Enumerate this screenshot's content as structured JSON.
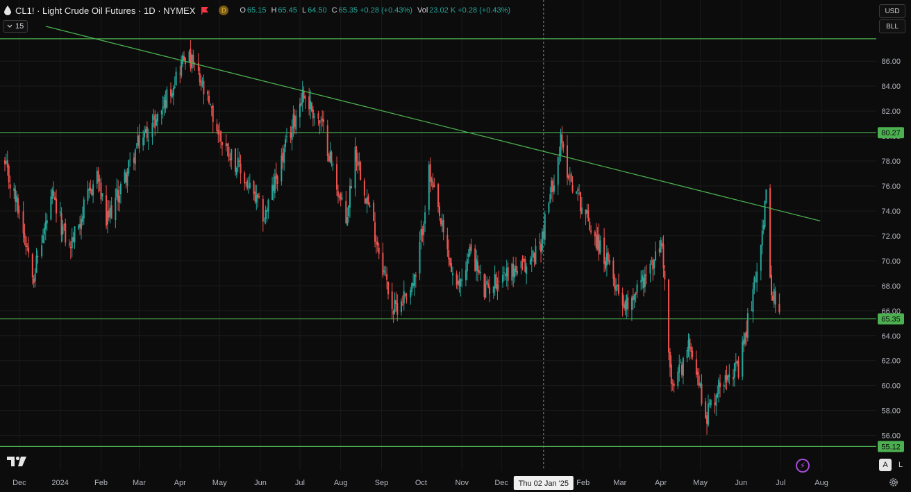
{
  "header": {
    "symbol": "CL1! · Light Crude Oil Futures · 1D · NYMEX",
    "d_badge": "D",
    "ohlc": [
      {
        "k": "O",
        "v": "65.15"
      },
      {
        "k": "H",
        "v": "65.45"
      },
      {
        "k": "L",
        "v": "64.50"
      },
      {
        "k": "C",
        "v": "65.35 +0.28 (+0.43%)"
      },
      {
        "k": "Vol",
        "v": "23.02 K +0.28 (+0.43%)"
      }
    ]
  },
  "interval_badge": "15",
  "currency_button": "USD",
  "unit_button": "BLL",
  "crosshair_label": "Thu 02 Jan '25",
  "toggles": {
    "auto": "A",
    "log": "L"
  },
  "colors": {
    "up": "#26a69a",
    "down": "#ef5350",
    "level": "#4caf50",
    "grid": "#1a1a1a",
    "label_bg": "#4caf50"
  },
  "chart_data": {
    "type": "candlestick",
    "title": "CL1! · Light Crude Oil Futures · 1D · NYMEX",
    "ylim": [
      54.5,
      88.5
    ],
    "yticks": [
      56,
      58,
      60,
      62,
      64,
      66,
      68,
      70,
      72,
      74,
      76,
      78,
      80,
      82,
      84,
      86
    ],
    "xticks": [
      "Dec",
      "2024",
      "Feb",
      "Mar",
      "Apr",
      "May",
      "Jun",
      "Jul",
      "Aug",
      "Sep",
      "Oct",
      "Nov",
      "Dec",
      "Feb",
      "Mar",
      "Apr",
      "May",
      "Jun",
      "Jul",
      "Aug"
    ],
    "x_range": [
      "2023-11-20",
      "2025-08-31"
    ],
    "grid": true,
    "horizontal_levels": [
      {
        "price": 87.8,
        "label": ""
      },
      {
        "price": 80.27,
        "label": "80.27"
      },
      {
        "price": 65.35,
        "label": "65.35"
      },
      {
        "price": 55.12,
        "label": "55.12"
      }
    ],
    "trendline": {
      "from": {
        "date": "2023-12-21",
        "price": 88.8
      },
      "to": {
        "date": "2025-07-31",
        "price": 73.2
      }
    },
    "crosshair": {
      "date": "2025-01-02"
    },
    "price_path": [
      [
        "2023-11-20",
        77.5
      ],
      [
        "2023-12-01",
        74.0
      ],
      [
        "2023-12-12",
        69.0
      ],
      [
        "2023-12-26",
        75.0
      ],
      [
        "2024-01-08",
        71.0
      ],
      [
        "2024-01-29",
        77.0
      ],
      [
        "2024-02-05",
        73.0
      ],
      [
        "2024-03-01",
        79.5
      ],
      [
        "2024-03-15",
        81.5
      ],
      [
        "2024-04-05",
        86.5
      ],
      [
        "2024-04-12",
        85.5
      ],
      [
        "2024-05-01",
        80.0
      ],
      [
        "2024-05-10",
        78.5
      ],
      [
        "2024-06-04",
        73.5
      ],
      [
        "2024-07-03",
        83.5
      ],
      [
        "2024-07-19",
        80.5
      ],
      [
        "2024-08-05",
        73.0
      ],
      [
        "2024-08-12",
        79.0
      ],
      [
        "2024-09-10",
        66.0
      ],
      [
        "2024-09-27",
        68.5
      ],
      [
        "2024-10-07",
        77.0
      ],
      [
        "2024-10-28",
        67.5
      ],
      [
        "2024-11-08",
        71.0
      ],
      [
        "2024-11-18",
        67.5
      ],
      [
        "2024-12-02",
        69.0
      ],
      [
        "2024-12-20",
        69.5
      ],
      [
        "2024-12-31",
        71.5
      ],
      [
        "2025-01-15",
        79.5
      ],
      [
        "2025-01-21",
        77.0
      ],
      [
        "2025-02-14",
        71.0
      ],
      [
        "2025-03-05",
        66.5
      ],
      [
        "2025-03-25",
        69.5
      ],
      [
        "2025-04-02",
        71.5
      ],
      [
        "2025-04-09",
        59.5
      ],
      [
        "2025-04-24",
        63.5
      ],
      [
        "2025-05-05",
        57.5
      ],
      [
        "2025-05-22",
        61.5
      ],
      [
        "2025-05-30",
        61.0
      ],
      [
        "2025-06-11",
        68.0
      ],
      [
        "2025-06-20",
        75.0
      ],
      [
        "2025-06-23",
        68.5
      ],
      [
        "2025-06-30",
        65.35
      ]
    ]
  }
}
